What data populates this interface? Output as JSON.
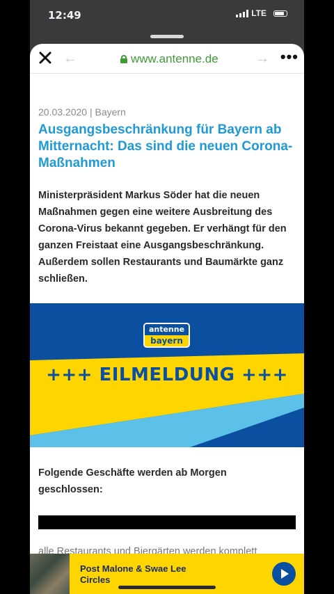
{
  "status": {
    "time": "12:49",
    "network": "LTE"
  },
  "browser": {
    "url": "www.antenne.de"
  },
  "article": {
    "meta": "20.03.2020 | Bayern",
    "title": "Ausgangsbeschränkung für Bayern ab Mitternacht: Das sind die neuen Corona-Maßnahmen",
    "lead": "Ministerpräsident Markus Söder hat die neuen Maßnahmen gegen eine weitere Ausbreitung des Corona-Virus bekannt gegeben. Er verhängt für den ganzen Freistaat eine Ausgangsbeschränkung. Außerdem sollen Restaurants und Baumärkte ganz schließen.",
    "banner": {
      "logo_top": "antenne",
      "logo_bottom": "bayern",
      "headline": "+++ EILMELDUNG +++"
    },
    "subhead": "Folgende Geschäfte werden ab Morgen geschlossen:",
    "partial": "alle Restaurants und Biergärten werden komplett"
  },
  "player": {
    "track": "Post Malone & Swae Lee",
    "title": "Circles"
  },
  "colors": {
    "accent": "#1f9ad6",
    "brand_blue": "#0a4fa0",
    "brand_yellow": "#ffd500",
    "secure_green": "#3f9c35"
  }
}
